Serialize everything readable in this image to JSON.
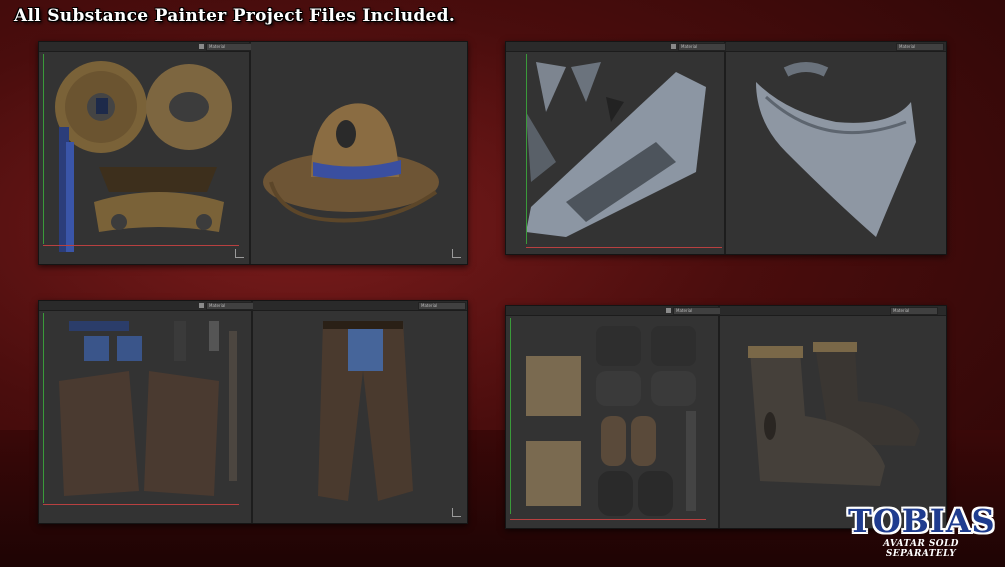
{
  "headline": "All Substance Painter Project Files Included.",
  "brand": {
    "name": "TOBIAS",
    "tagline": "AVATAR SOLD SEPARATELY"
  },
  "panels": {
    "hat": {
      "material_label": "Material"
    },
    "bandana": {
      "material_label": "Material"
    },
    "chaps": {
      "material_label": "Material"
    },
    "boots": {
      "material_label": "Material"
    }
  }
}
